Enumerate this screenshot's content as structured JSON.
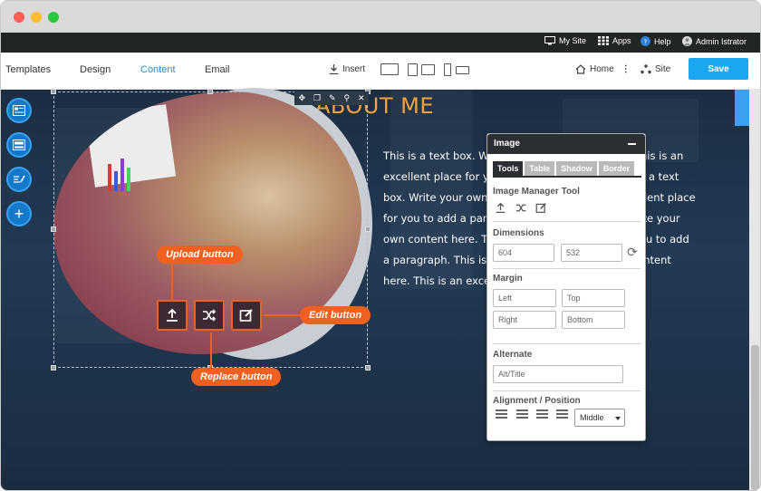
{
  "adminbar": {
    "my_site": "My Site",
    "apps": "Apps",
    "help": "Help",
    "user": "Admin Istrator"
  },
  "toolbar": {
    "tabs": [
      "Templates",
      "Design",
      "Content",
      "Email"
    ],
    "active_tab": "Content",
    "insert_label": "Insert",
    "home_label": "Home",
    "site_label": "Site",
    "save_label": "Save"
  },
  "canvas": {
    "heading": "ABOUT ME",
    "text": "This is a text box. Write your own content here. This is an excellent place for you to add a paragraph. This is a text box. Write your own content here. This is an excellent place for you to add a paragraph. This is a text box. Write your own content here. This is an excellent place for you to add a paragraph. This is a text box. Write your own content here. This is an excellent place for you"
  },
  "callouts": {
    "upload": "Upload button",
    "replace": "Replace button",
    "edit": "Edit button"
  },
  "panel": {
    "title": "Image",
    "tabs": [
      "Tools",
      "Table",
      "Shadow",
      "Border"
    ],
    "image_manager_label": "Image Manager Tool",
    "dimensions_label": "Dimensions",
    "width_value": "604",
    "height_value": "532",
    "margin_label": "Margin",
    "margin_left": "Left",
    "margin_top": "Top",
    "margin_right": "Right",
    "margin_bottom": "Bottom",
    "alternate_label": "Alternate",
    "alt_placeholder": "Alt/Title",
    "alignment_label": "Alignment / Position",
    "alignment_value": "Middle"
  },
  "colors": {
    "accent": "#1ba7f0",
    "callout": "#f06020",
    "heading": "#f4a23c"
  }
}
